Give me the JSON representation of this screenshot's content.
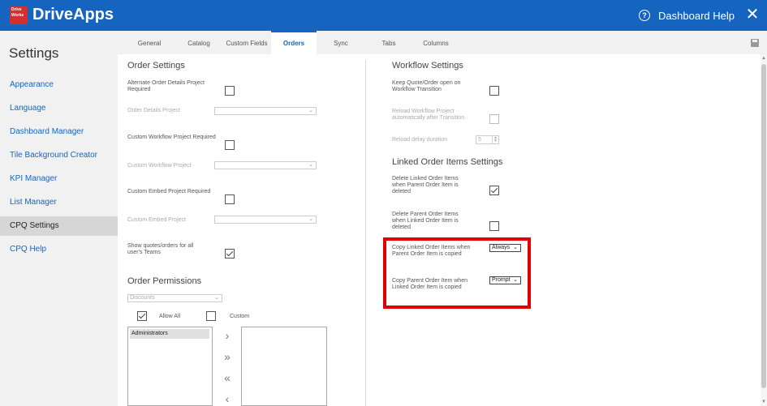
{
  "header": {
    "logo_text_1": "Drive",
    "logo_text_2": "Works",
    "brand_name": "DriveApps",
    "help_label": "Dashboard Help",
    "close_symbol": "✕",
    "help_symbol": "?",
    "bar_color": "#1565c0"
  },
  "sidebar": {
    "title": "Settings",
    "items": [
      {
        "label": "Appearance"
      },
      {
        "label": "Language"
      },
      {
        "label": "Dashboard Manager"
      },
      {
        "label": "Tile Background Creator"
      },
      {
        "label": "KPI Manager"
      },
      {
        "label": "List Manager"
      },
      {
        "label": "CPQ Settings",
        "active": true
      },
      {
        "label": "CPQ Help"
      }
    ]
  },
  "tabs": [
    {
      "label": "General"
    },
    {
      "label": "Catalog"
    },
    {
      "label": "Custom Fields"
    },
    {
      "label": "Orders",
      "active": true
    },
    {
      "label": "Sync"
    },
    {
      "label": "Tabs"
    },
    {
      "label": "Columns"
    }
  ],
  "order_settings": {
    "heading": "Order Settings",
    "alt_details_label": "Alternate Order Details Project Required",
    "alt_details_checked": false,
    "order_details_project_label": "Order Details Project",
    "custom_workflow_label": "Custom Workflow Project Required",
    "custom_workflow_checked": false,
    "custom_workflow_project_label": "Custom Workflow Project",
    "custom_embed_label": "Custom Embed Project Required",
    "custom_embed_checked": false,
    "custom_embed_project_label": "Custom Embed Project",
    "show_teams_label": "Show quotes/orders for all user's Teams",
    "show_teams_checked": true
  },
  "order_permissions": {
    "heading": "Order Permissions",
    "select_value": "Discounts",
    "allow_all_label": "Allow All",
    "allow_all_checked": true,
    "custom_label": "Custom",
    "custom_checked": false,
    "left_list": [
      "Administrators"
    ],
    "right_list": [],
    "move_right": "›",
    "move_all_right": "»",
    "move_all_left": "«",
    "move_left": "‹"
  },
  "workflow_settings": {
    "heading": "Workflow Settings",
    "keep_open_label": "Keep Quote/Order open on Workflow Transition",
    "keep_open_checked": false,
    "reload_label": "Reload Workflow Project automatically after Transition",
    "reload_checked": false,
    "reload_delay_label": "Reload delay duration",
    "reload_delay_value": "5"
  },
  "linked_items": {
    "heading": "Linked Order Items Settings",
    "delete_linked_label": "Delete Linked Order Items when Parent Order Item is deleted",
    "delete_linked_checked": true,
    "delete_parent_label": "Delete Parent Order Items when Linked Order Item is deleted",
    "delete_parent_checked": false,
    "copy_linked_label": "Copy Linked Order Items when Parent Order Item is copied",
    "copy_linked_value": "Always",
    "copy_parent_label": "Copy Parent Order Item when Linked Order Item is copied",
    "copy_parent_value": "Prompt"
  },
  "highlight_color": "#e00000"
}
